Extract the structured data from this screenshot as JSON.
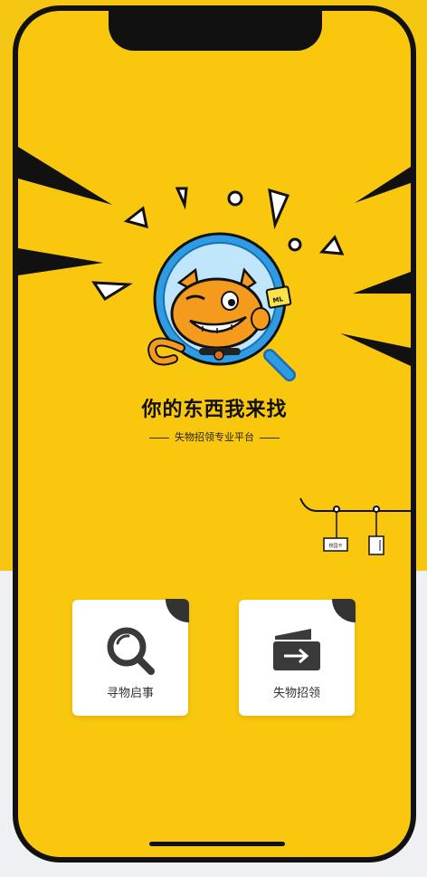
{
  "hero": {
    "title": "你的东西我来找",
    "subtitle": "失物招领专业平台",
    "tag_left": "校园卡"
  },
  "cards": [
    {
      "label": "寻物启事",
      "icon": "magnifier-icon"
    },
    {
      "label": "失物招领",
      "icon": "card-arrow-icon"
    }
  ],
  "colors": {
    "brand_yellow": "#f9c80e",
    "magnifier_blue": "#2f9be3",
    "icon_dark": "#3a3a3a"
  }
}
